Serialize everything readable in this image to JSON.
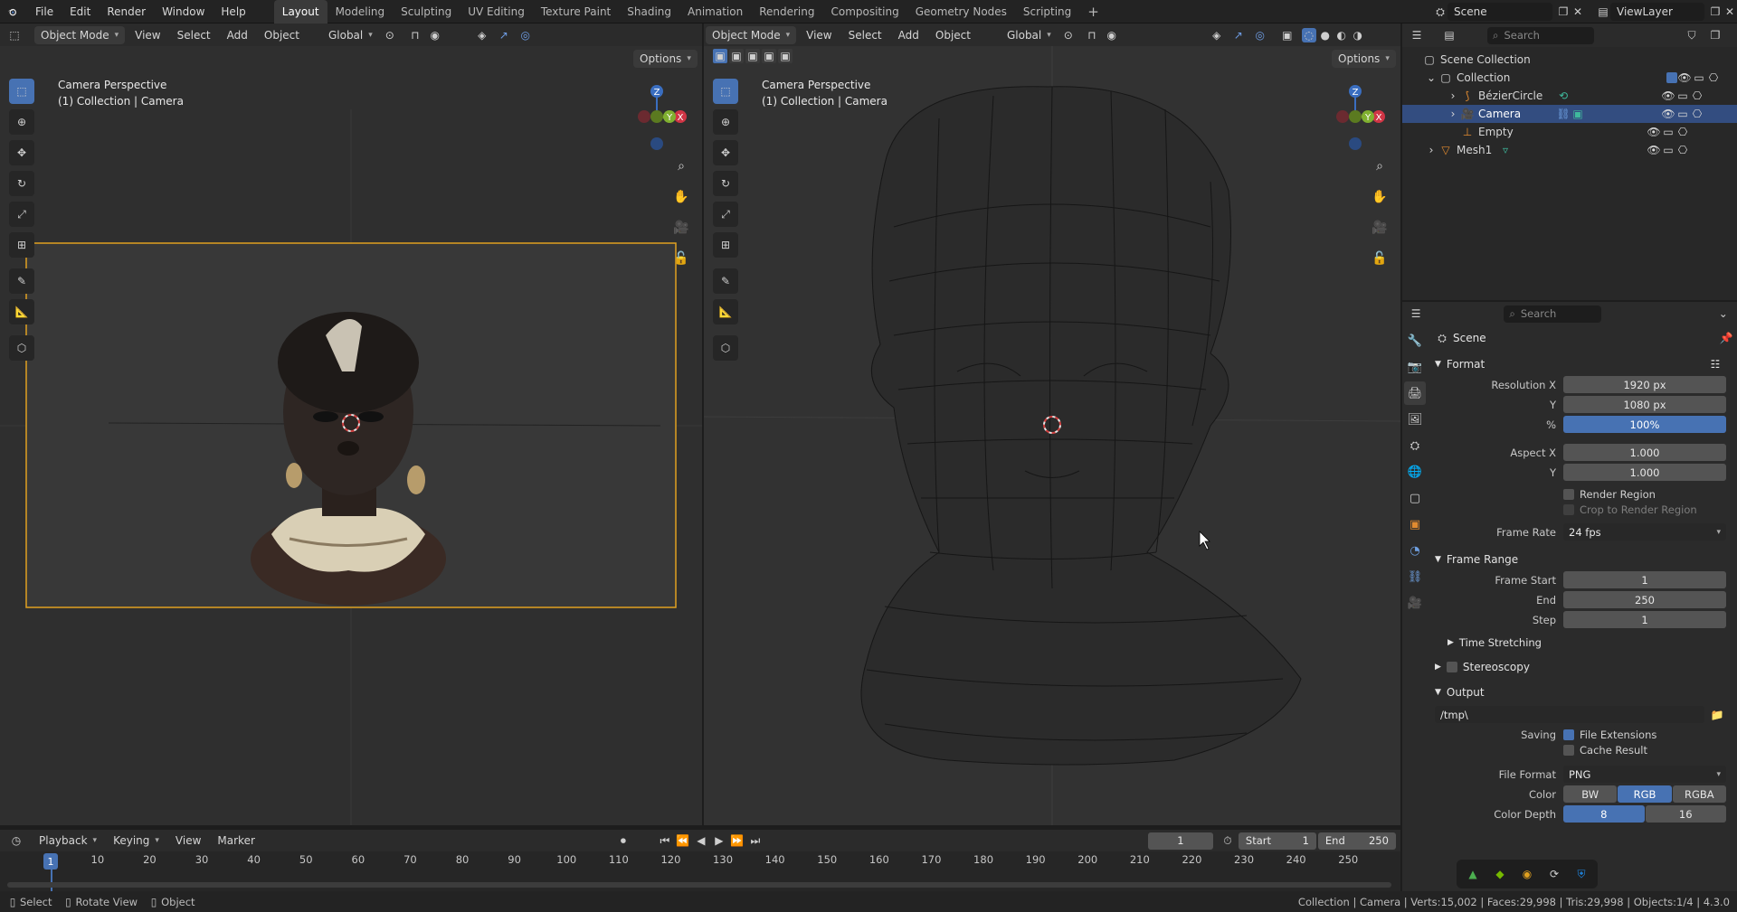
{
  "menubar": {
    "items": [
      "File",
      "Edit",
      "Render",
      "Window",
      "Help"
    ],
    "workspaces": [
      "Layout",
      "Modeling",
      "Sculpting",
      "UV Editing",
      "Texture Paint",
      "Shading",
      "Animation",
      "Rendering",
      "Compositing",
      "Geometry Nodes",
      "Scripting"
    ],
    "active_workspace": "Layout",
    "scene_name": "Scene",
    "view_layer_name": "ViewLayer"
  },
  "viewport_left": {
    "mode": "Object Mode",
    "menus": [
      "View",
      "Select",
      "Add",
      "Object"
    ],
    "orientation": "Global",
    "options_label": "Options",
    "overlay_title": "Camera Perspective",
    "overlay_subtitle": "(1) Collection | Camera"
  },
  "viewport_right": {
    "mode": "Object Mode",
    "menus": [
      "View",
      "Select",
      "Add",
      "Object"
    ],
    "orientation": "Global",
    "options_label": "Options",
    "overlay_title": "Camera Perspective",
    "overlay_subtitle": "(1) Collection | Camera"
  },
  "outliner": {
    "search_placeholder": "Search",
    "root": "Scene Collection",
    "collection": "Collection",
    "items": [
      "BézierCircle",
      "Camera",
      "Empty"
    ],
    "mesh": "Mesh1",
    "selected": "Camera"
  },
  "properties": {
    "search_placeholder": "Search",
    "context": "Scene",
    "format": {
      "header": "Format",
      "resolution_x_label": "Resolution X",
      "resolution_x": "1920 px",
      "resolution_y_label": "Y",
      "resolution_y": "1080 px",
      "percent_label": "%",
      "percent": "100%",
      "aspect_x_label": "Aspect X",
      "aspect_x": "1.000",
      "aspect_y_label": "Y",
      "aspect_y": "1.000",
      "render_region": "Render Region",
      "crop_region": "Crop to Render Region",
      "frame_rate_label": "Frame Rate",
      "frame_rate": "24 fps"
    },
    "frame_range": {
      "header": "Frame Range",
      "start_label": "Frame Start",
      "start": "1",
      "end_label": "End",
      "end": "250",
      "step_label": "Step",
      "step": "1"
    },
    "time_stretching": "Time Stretching",
    "stereoscopy": "Stereoscopy",
    "output": {
      "header": "Output",
      "path": "/tmp\\",
      "saving_label": "Saving",
      "file_extensions": "File Extensions",
      "cache_result": "Cache Result",
      "file_format_label": "File Format",
      "file_format": "PNG",
      "color_label": "Color",
      "color_options": [
        "BW",
        "RGB",
        "RGBA"
      ],
      "color_selected": "RGB",
      "color_depth_label": "Color Depth",
      "color_depth_options": [
        "8",
        "16"
      ],
      "color_depth_selected": "8"
    }
  },
  "timeline": {
    "menus": [
      "Playback",
      "Keying",
      "View",
      "Marker"
    ],
    "current_frame": "1",
    "start_label": "Start",
    "start": "1",
    "end_label": "End",
    "end": "250",
    "ticks": [
      "1",
      "10",
      "20",
      "30",
      "40",
      "50",
      "60",
      "70",
      "80",
      "90",
      "100",
      "110",
      "120",
      "130",
      "140",
      "150",
      "160",
      "170",
      "180",
      "190",
      "200",
      "210",
      "220",
      "230",
      "240",
      "250"
    ]
  },
  "statusbar": {
    "select": "Select",
    "rotate": "Rotate View",
    "object": "Object",
    "stats": "Collection | Camera | Verts:15,002 | Faces:29,998 | Tris:29,998 | Objects:1/4 | 4.3.0"
  },
  "colors": {
    "accent": "#4772b3",
    "selected_row": "#334d80",
    "camera_frame": "#e0a020"
  }
}
